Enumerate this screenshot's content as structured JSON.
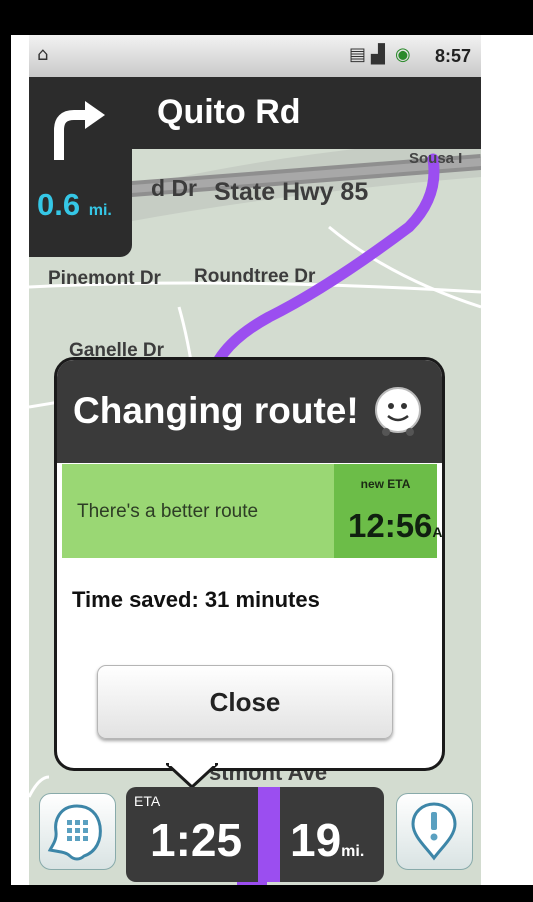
{
  "status_bar": {
    "time": "8:57",
    "icons": [
      "usb-icon",
      "network-type-icon",
      "signal-icon",
      "battery-icon"
    ]
  },
  "navigation": {
    "street_name": "Quito Rd",
    "turn_direction": "right",
    "distance_value": "0.6",
    "distance_unit": "mi."
  },
  "map": {
    "labels": {
      "partial_road": "d Dr",
      "state_hwy": "State Hwy 85",
      "sousa": "Sousa I",
      "pinemont": "Pinemont Dr",
      "roundtree": "Roundtree Dr",
      "ganelle": "Ganelle Dr",
      "westmont": "stmont Ave"
    },
    "route_color": "#9b4ef0"
  },
  "dialog": {
    "title": "Changing route!",
    "better_route": "There's a better route",
    "new_eta_label": "new ETA",
    "new_eta_time": "12:56",
    "new_eta_ampm": "AM",
    "time_saved": "Time saved: 31 minutes",
    "close_label": "Close"
  },
  "eta_bar": {
    "eta_label": "ETA",
    "eta_time": "1:25",
    "distance_value": "19",
    "distance_unit": "mi."
  },
  "colors": {
    "accent_blue": "#35c7e6",
    "route_green": "#9ad774",
    "eta_green": "#6cbd48",
    "panel_dark": "#3a3a3a"
  }
}
